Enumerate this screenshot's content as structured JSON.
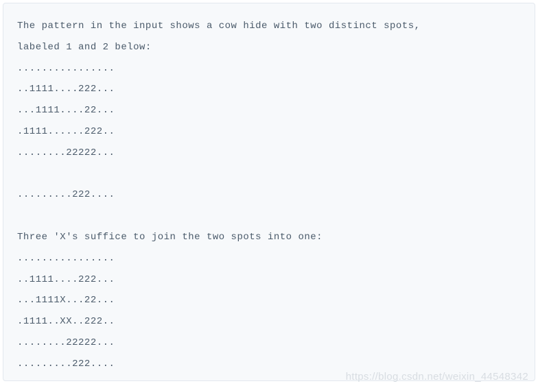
{
  "code": {
    "intro": "The pattern in the input shows a cow hide with two distinct spots,\nlabeled 1 and 2 below:",
    "grid1": "................\n..1111....222...\n...1111....22...\n.1111......222..\n........22222...\n\n.........222....",
    "mid": "Three 'X's suffice to join the two spots into one:",
    "grid2": "................\n..1111....222...\n...1111X...22...\n.1111..XX..222..\n........22222...\n.........222...."
  },
  "watermark": "https://blog.csdn.net/weixin_44548342"
}
